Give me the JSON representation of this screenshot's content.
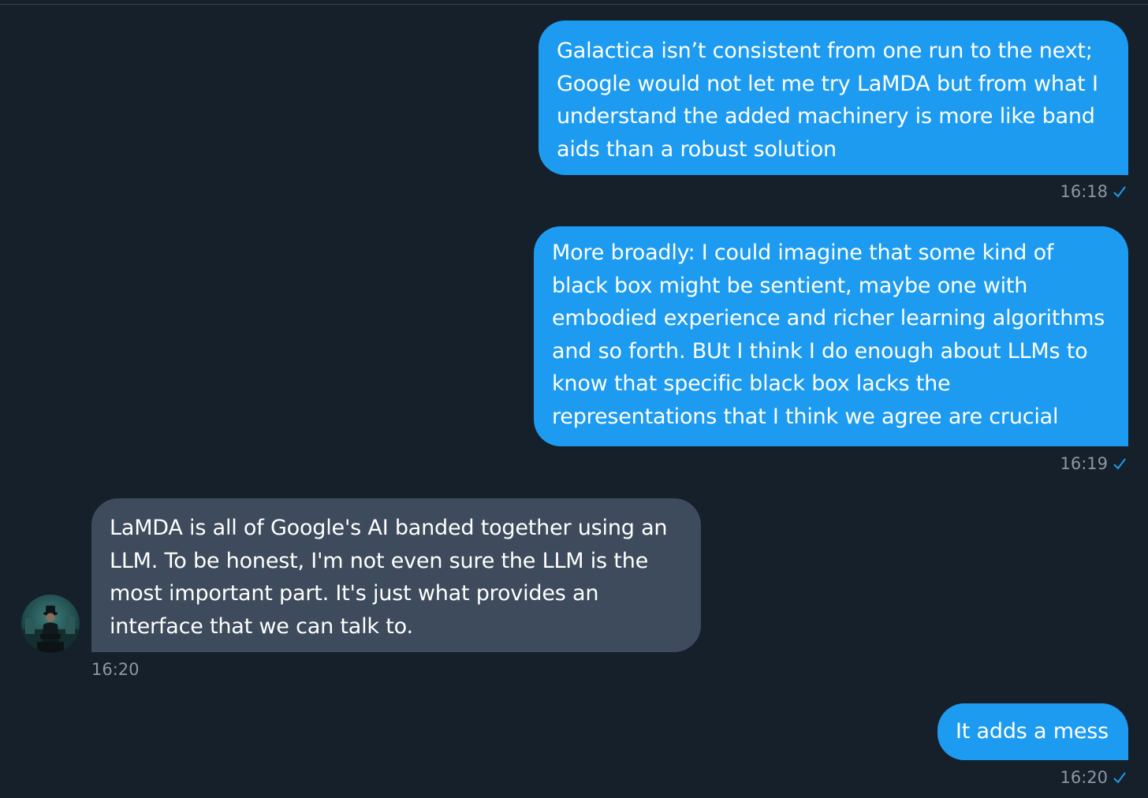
{
  "conversation": {
    "messages": [
      {
        "direction": "sent",
        "text": "Galactica isn’t consistent from one run to the next;\nGoogle would not let me try LaMDA but from what I\nunderstand the added machinery is more like band\naids than a robust solution",
        "time": "16:18",
        "read_icon": "check-icon"
      },
      {
        "direction": "sent",
        "text": "More broadly: I could imagine that some kind of\nblack box might be sentient, maybe one with\nembodied experience and richer learning algorithms\nand so forth. BUt I think I do enough about LLMs to\nknow that specific black box lacks the\nrepresentations that I think we agree are crucial",
        "time": "16:19",
        "read_icon": "check-icon"
      },
      {
        "direction": "received",
        "text": "LaMDA is all of Google's AI banded together using an\nLLM.  To be honest, I'm not even sure the LLM is the\nmost important part.  It's just what provides an\ninterface that we can talk to.",
        "time": "16:20",
        "avatar_icon": "user-avatar"
      },
      {
        "direction": "sent",
        "text": "It adds a mess",
        "time": "16:20",
        "read_icon": "check-icon"
      }
    ]
  },
  "colors": {
    "background": "#15202b",
    "sent_bubble": "#1d9bf0",
    "received_bubble": "#3d4b5c",
    "timestamp": "#8b98a5",
    "check": "#1d9bf0"
  }
}
